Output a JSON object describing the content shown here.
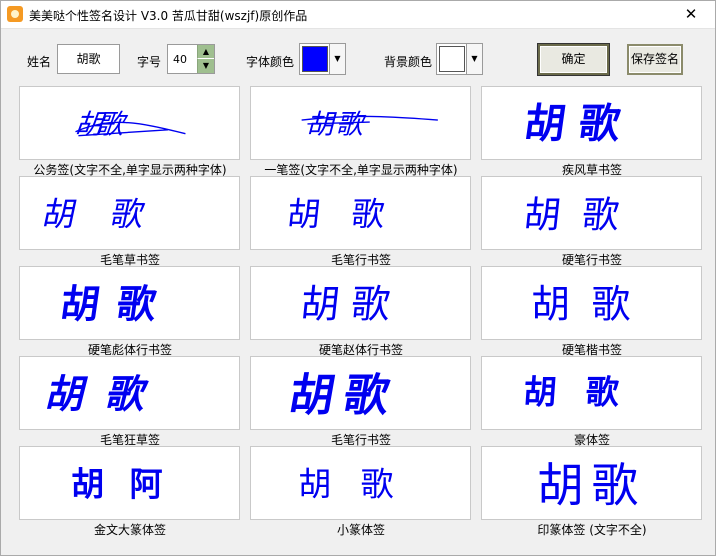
{
  "titlebar": {
    "title": "美美哒个性签名设计 V3.0  苦瓜甘甜(wszjf)原创作品",
    "icon": "app-logo-icon",
    "close_glyph": "✕"
  },
  "controls": {
    "name_label": "姓名",
    "name_value": "胡歌",
    "size_label": "字号",
    "size_value": "40",
    "font_color_label": "字体颜色",
    "font_color": "#0000ff",
    "bg_color_label": "背景颜色",
    "bg_color": "#ffffff",
    "confirm_label": "确定",
    "save_label": "保存签名"
  },
  "signature_color": "#0000f0",
  "cards": [
    {
      "caption": "公务签(文字不全,单字显示两种字体)",
      "preview": "胡歌"
    },
    {
      "caption": "一笔签(文字不全,单字显示两种字体)",
      "preview": "胡歌"
    },
    {
      "caption": "疾风草书签",
      "preview": "胡歌"
    },
    {
      "caption": "毛笔草书签",
      "preview": "胡歌"
    },
    {
      "caption": "毛笔行书签",
      "preview": "胡歌"
    },
    {
      "caption": "硬笔行书签",
      "preview": "胡歌"
    },
    {
      "caption": "硬笔彪体行书签",
      "preview": "胡歌"
    },
    {
      "caption": "硬笔赵体行书签",
      "preview": "胡歌"
    },
    {
      "caption": "硬笔楷书签",
      "preview": "胡歌"
    },
    {
      "caption": "毛笔狂草签",
      "preview": "胡歌"
    },
    {
      "caption": "毛笔行书签",
      "preview": "胡歌"
    },
    {
      "caption": "豪体签",
      "preview": "胡歌"
    },
    {
      "caption": "金文大篆体签",
      "preview": "胡阿"
    },
    {
      "caption": "小篆体签",
      "preview": "胡歌"
    },
    {
      "caption": "印篆体签 (文字不全)",
      "preview": "胡歌"
    }
  ]
}
